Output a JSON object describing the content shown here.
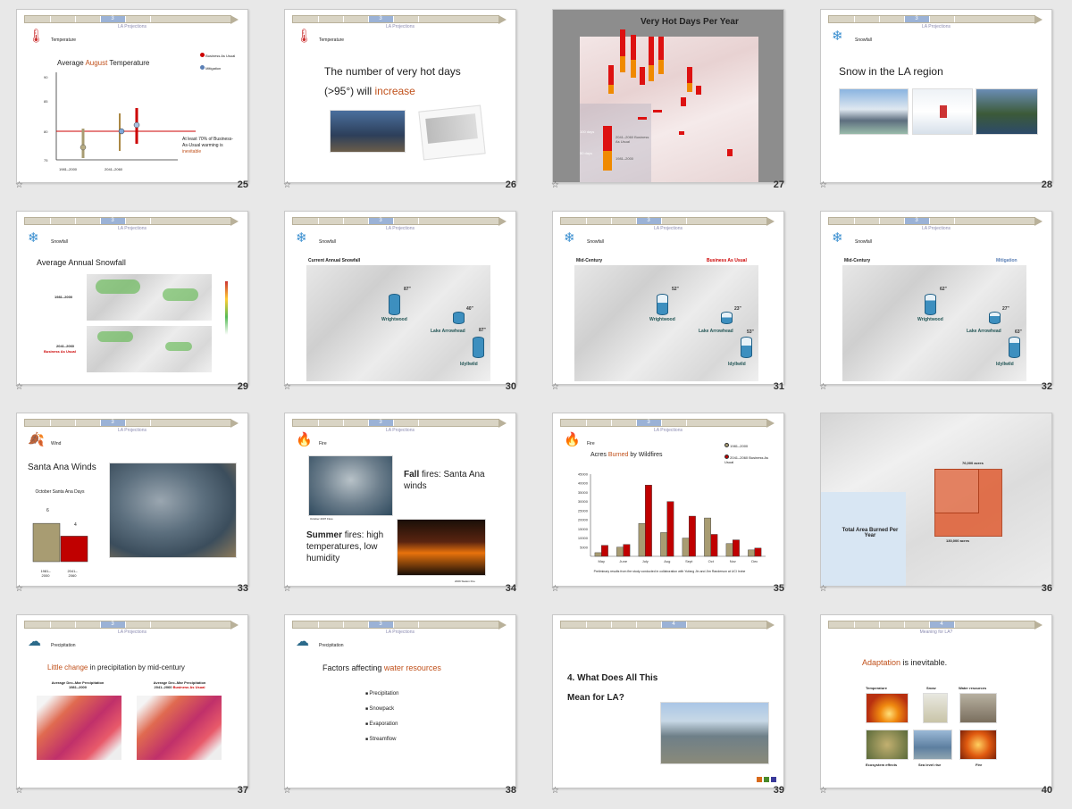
{
  "section_labels": {
    "s3": "3",
    "s4": "4"
  },
  "common": {
    "projections": "LA Projections",
    "meaning": "Meaning for LA?"
  },
  "slides": {
    "s25": {
      "num": "25",
      "label": "Temperature",
      "title_a": "Average ",
      "title_b": "August",
      "title_c": " Temperature",
      "legend1": "Business As Usual",
      "legend2": "Mitigation",
      "y": [
        "90",
        "85",
        "80",
        "75"
      ],
      "x1": "1981–2000",
      "x2": "2041–2060",
      "note_a": "At least 70% of Business-As-Usual warming is ",
      "note_b": "inevitable"
    },
    "s26": {
      "num": "26",
      "label": "Temperature",
      "line1": "The number  of very hot days",
      "line2a": "(>95°)  will ",
      "line2b": "increase"
    },
    "s27": {
      "num": "27",
      "title": "Very Hot Days Per Year",
      "l100": "100 days",
      "l50": "50 days",
      "k1": "2041–2060 Business As Usual",
      "k2": "1981–2000"
    },
    "s28": {
      "num": "28",
      "label": "Snowfall",
      "title": "Snow in the LA region"
    },
    "s29": {
      "num": "29",
      "label": "Snowfall",
      "title": "Average Annual Snowfall",
      "r1": "1981–2000",
      "r2": "2041–2060",
      "r2b": "Business  As Usual"
    },
    "s30": {
      "num": "30",
      "label": "Snowfall",
      "title": "Current Annual Snowfall",
      "v1": "87\"",
      "v2": "40\"",
      "v3": "87\"",
      "p1": "Wrightwood",
      "p2": "Lake Arrowhead",
      "p3": "Idyllwild"
    },
    "s31": {
      "num": "31",
      "label": "Snowfall",
      "left": "Mid-Century",
      "right": "Business As Usual",
      "v1": "52\"",
      "v2": "23\"",
      "v3": "53\"",
      "p1": "Wrightwood",
      "p2": "Lake Arrowhead",
      "p3": "Idyllwild"
    },
    "s32": {
      "num": "32",
      "label": "Snowfall",
      "left": "Mid-Century",
      "right": "Mitigation",
      "v1": "62\"",
      "v2": "27\"",
      "v3": "63\"",
      "p1": "Wrightwood",
      "p2": "Lake Arrowhead",
      "p3": "Idyllwild"
    },
    "s33": {
      "num": "33",
      "label": "Wind",
      "title": "Santa Ana Winds",
      "sub": "October Santa Ana Days",
      "b1": "6",
      "b2": "4",
      "x1": "1981–2000",
      "x2": "2041–2060"
    },
    "s34": {
      "num": "34",
      "label": "Fire",
      "fall_a": "Fall",
      "fall_b": " fires: Santa Ana winds",
      "summer_a": "Summer",
      "summer_b": " fires: high temperatures, low humidity",
      "cap1": "October 2007 Fires",
      "cap2": "2009 Station Fire"
    },
    "s35": {
      "num": "35",
      "label": "Fire",
      "title_a": "Acres ",
      "title_b": "Burned",
      "title_c": " by Wildfires",
      "leg1": "1981–2000",
      "leg2": "2041–2060 Business As Usual",
      "foot": "Preliminary results from fire study conducted in collaboration with Yufang Jin and Jim Randerson at UCI Irvine"
    },
    "s36": {
      "num": "36",
      "title": "Total Area Burned Per Year",
      "a1": "76,000 acres",
      "a2": "130,000 acres"
    },
    "s37": {
      "num": "37",
      "label": "Precipitation",
      "title_a": "Little change",
      "title_b": " in precipitation by mid-century",
      "m1a": "Average Dec–Mar Precipitation",
      "m1b": "1981–2000",
      "m2a": "Average Dec–Mar Precipitation",
      "m2b": "2041–2060 ",
      "m2c": "Business As Usual"
    },
    "s38": {
      "num": "38",
      "label": "Precipitation",
      "title_a": "Factors affecting ",
      "title_b": "water resources",
      "items": [
        "Precipitation",
        "Snowpack",
        "Evaporation",
        "Streamflow"
      ]
    },
    "s39": {
      "num": "39",
      "line1": "4. What Does All This",
      "line2": "Mean for LA?"
    },
    "s40": {
      "num": "40",
      "title_a": "Adaptation",
      "title_b": " is inevitable.",
      "c1": "Temperature",
      "c2": "Snow",
      "c3": "Water resources",
      "c4": "Ecosystem effects",
      "c5": "Sea level rise",
      "c6": "Fire"
    }
  },
  "chart_data": [
    {
      "type": "bar",
      "title": "Acres Burned by Wildfires",
      "categories": [
        "May",
        "June",
        "July",
        "Aug",
        "Sept",
        "Oct",
        "Nov",
        "Dec"
      ],
      "ylim": [
        0,
        45000
      ],
      "series": [
        {
          "name": "1981–2000",
          "values": [
            2000,
            5000,
            18000,
            13000,
            10000,
            21000,
            7000,
            3500
          ]
        },
        {
          "name": "2041–2060 Business As Usual",
          "values": [
            6000,
            6500,
            39000,
            30000,
            22000,
            12000,
            9000,
            4500
          ]
        }
      ],
      "yticks": [
        "45000",
        "40000",
        "35000",
        "30000",
        "25000",
        "20000",
        "15000",
        "10000",
        "5000"
      ]
    },
    {
      "type": "bar",
      "title": "October Santa Ana Days",
      "categories": [
        "1981–2000",
        "2041–2060"
      ],
      "values": [
        6,
        4
      ]
    }
  ],
  "colors": {
    "accent": "#c0501a",
    "bau": "#c00000",
    "mit": "#5a7fb5",
    "hist": "#a89c72"
  }
}
